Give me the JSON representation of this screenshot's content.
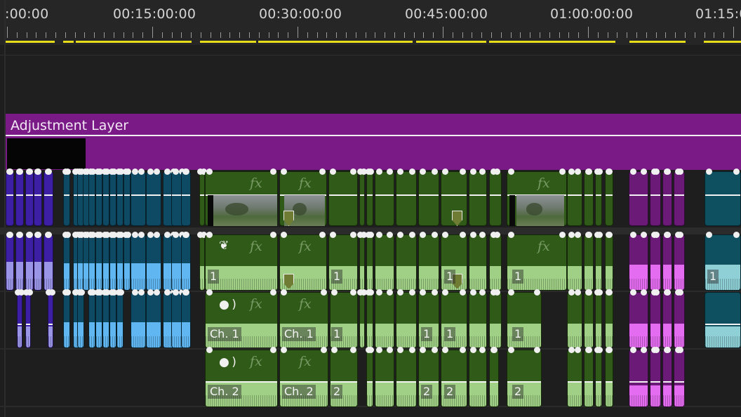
{
  "ruler": {
    "timecodes": [
      ":00:00",
      "00:15:00:00",
      "00:30:00:00",
      "00:45:00:00",
      "01:00:00:00",
      "01:15:0"
    ]
  },
  "adjustment_layer": {
    "title": "Adjustment Layer"
  },
  "colors": {
    "adjustment": "#7a1a86",
    "green_clip": "#2f5a17",
    "green_audio": "#9fd086",
    "blue_clip": "#0e4a63",
    "blue_audio": "#5fb6f0",
    "violet_clip": "#3d1fa6",
    "violet_audio": "#9b95e8",
    "magenta_clip": "#6b1a78",
    "magenta_audio": "#e46cf0",
    "teal_clip": "#0f5060",
    "teal_audio": "#8fd0d6",
    "playhead_bar": "#e7dc19"
  },
  "icons": {
    "audio_retime": "leaf-slash-icon",
    "speech": "speaking-head-icon",
    "marker": "clip-marker-icon"
  },
  "labels": {
    "fx": "fx",
    "ch1": "Ch. 1",
    "ch2": "Ch. 2",
    "n1": "1",
    "n2": "2"
  }
}
